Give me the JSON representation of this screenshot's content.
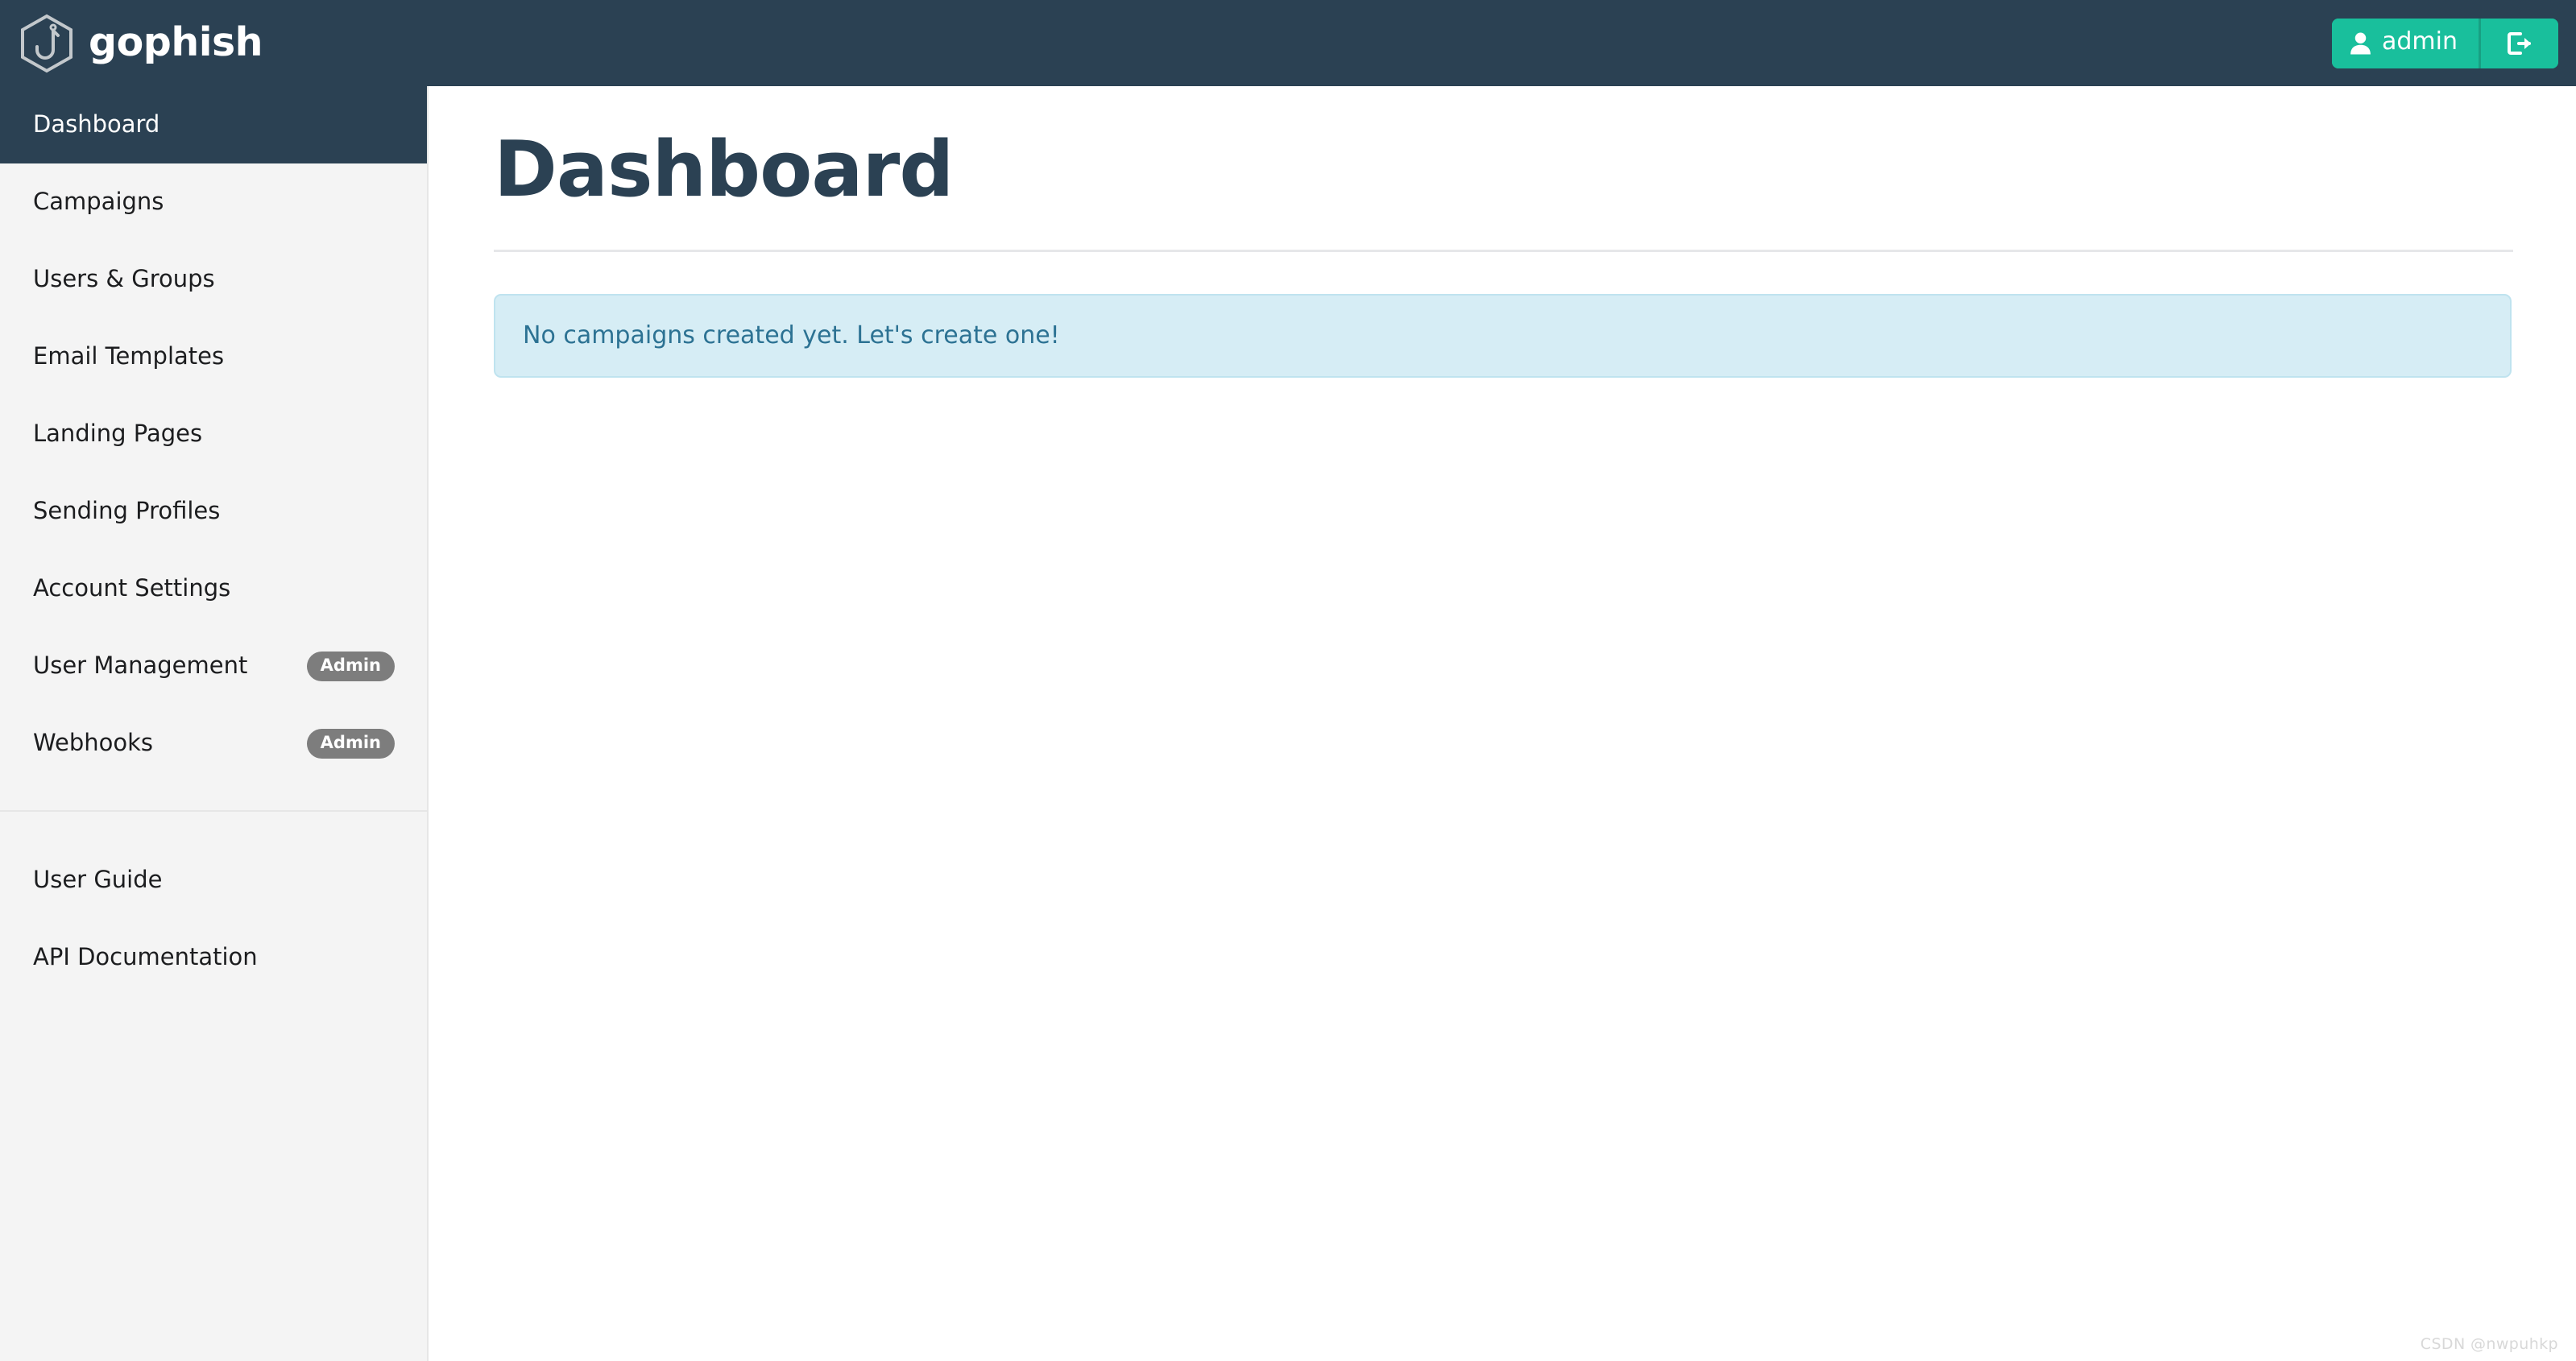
{
  "header": {
    "brand_name": "gophish",
    "logo_icon": "gophish-hexagon-hook-logo",
    "user_name": "admin",
    "user_icon": "user-icon",
    "logout_icon": "sign-out-icon",
    "accent_color": "#19bf9c",
    "background_color": "#2b4153"
  },
  "sidebar": {
    "background_color": "#f4f4f4",
    "active_color": "#2b4153",
    "items": [
      {
        "label": "Dashboard",
        "active": true,
        "badge": ""
      },
      {
        "label": "Campaigns",
        "active": false,
        "badge": ""
      },
      {
        "label": "Users & Groups",
        "active": false,
        "badge": ""
      },
      {
        "label": "Email Templates",
        "active": false,
        "badge": ""
      },
      {
        "label": "Landing Pages",
        "active": false,
        "badge": ""
      },
      {
        "label": "Sending Profiles",
        "active": false,
        "badge": ""
      },
      {
        "label": "Account Settings",
        "active": false,
        "badge": ""
      },
      {
        "label": "User Management",
        "active": false,
        "badge": "Admin"
      },
      {
        "label": "Webhooks",
        "active": false,
        "badge": "Admin"
      }
    ],
    "footer_items": [
      {
        "label": "User Guide"
      },
      {
        "label": "API Documentation"
      }
    ]
  },
  "main": {
    "page_title": "Dashboard",
    "alert": {
      "message": "No campaigns created yet. Let's create one!",
      "type": "info",
      "background_color": "#d6edf5",
      "text_color": "#2c7293"
    }
  },
  "watermark": {
    "text": "CSDN @nwpuhkp"
  }
}
